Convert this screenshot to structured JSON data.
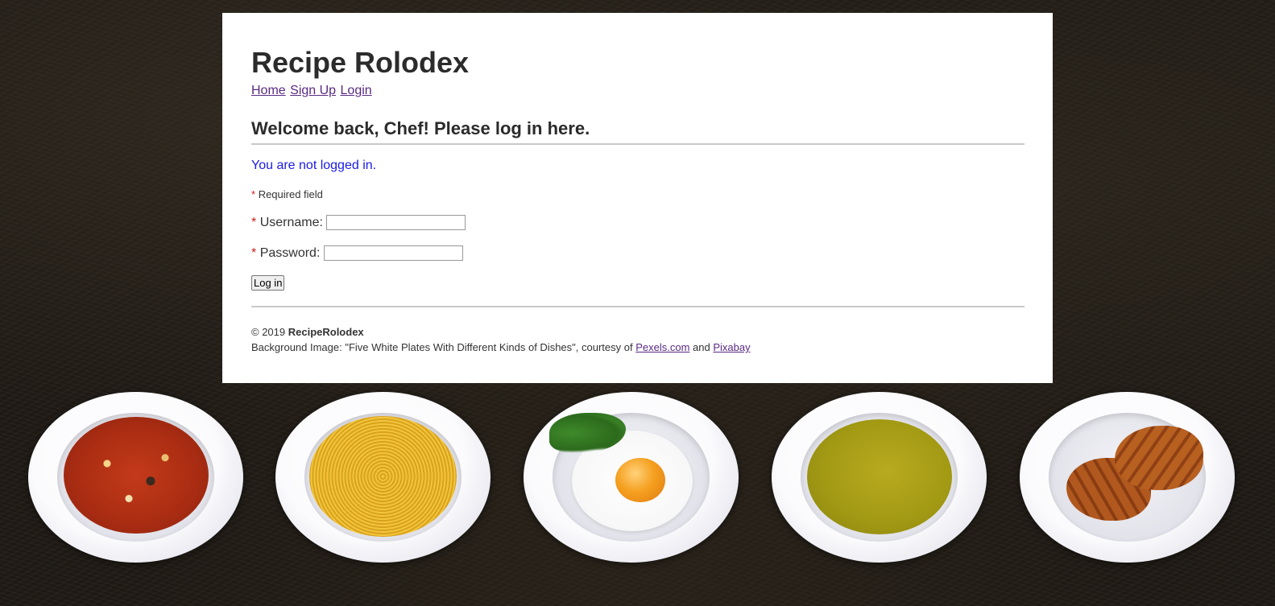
{
  "site": {
    "title": "Recipe Rolodex"
  },
  "nav": {
    "home": "Home",
    "signup": "Sign Up",
    "login": "Login"
  },
  "page": {
    "heading": "Welcome back, Chef! Please log in here.",
    "status": "You are not logged in."
  },
  "form": {
    "required_star": "*",
    "required_note": "Required field",
    "username_label": "Username:",
    "username_value": "",
    "password_label": "Password:",
    "password_value": "",
    "submit_label": "Log in"
  },
  "footer": {
    "copyright_prefix": "© 2019 ",
    "brand": "RecipeRolodex",
    "credit_text": "Background Image: \"Five White Plates With Different Kinds of Dishes\", courtesy of ",
    "link_pexels": "Pexels.com",
    "and_text": " and ",
    "link_pixabay": "Pixabay"
  },
  "colors": {
    "status_blue": "#1a1ae6",
    "required_red": "#d11a1a",
    "link_purple": "#5a2a82"
  },
  "background_plates": [
    "minestrone-soup",
    "spaghetti",
    "fried-egg",
    "pea-soup",
    "croissants"
  ]
}
